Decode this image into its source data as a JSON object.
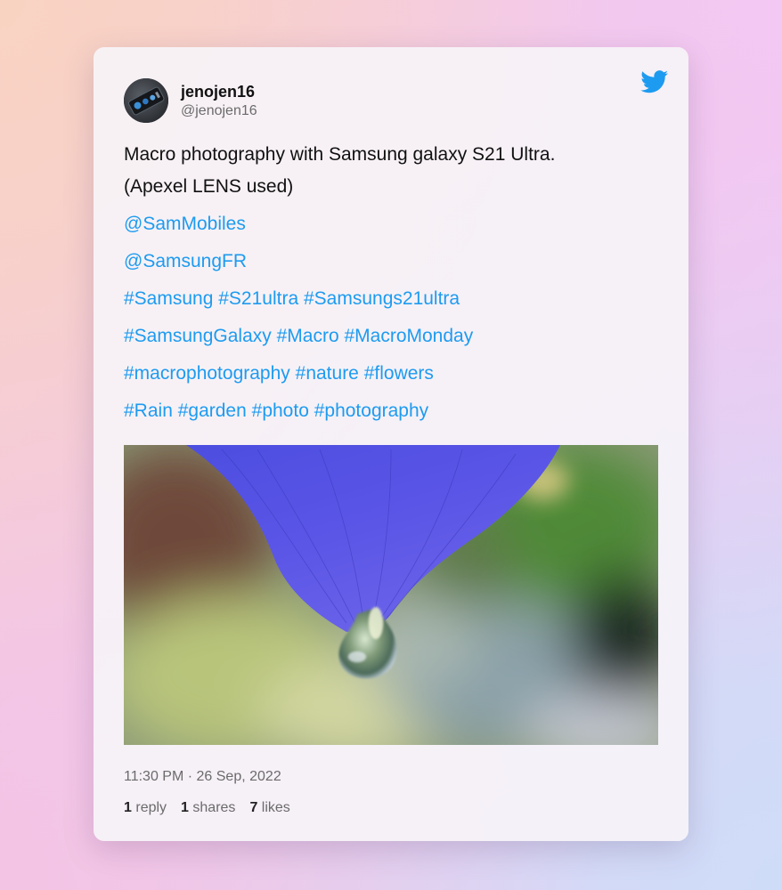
{
  "user": {
    "display_name": "jenojen16",
    "handle": "@jenojen16",
    "avatar_icon": "phone-camera-avatar"
  },
  "brand": {
    "logo_icon": "twitter-bird-icon",
    "accent_color": "#1d9bf0"
  },
  "tweet": {
    "text_line1": "Macro photography with Samsung galaxy S21 Ultra.",
    "text_line2": "(Apexel LENS used)",
    "mention1": "@SamMobiles",
    "mention2": "@SamsungFR",
    "hashtag_lines": [
      [
        "#Samsung",
        "#S21ultra",
        "#Samsungs21ultra"
      ],
      [
        "#SamsungGalaxy",
        "#Macro",
        "#MacroMonday"
      ],
      [
        "#macrophotography",
        "#nature",
        "#flowers"
      ],
      [
        "#Rain",
        "#garden",
        "#photo",
        "#photography"
      ]
    ],
    "image_description_icon": "macro-photo-purple-petal-water-drop",
    "timestamp": "11:30 PM · 26 Sep, 2022"
  },
  "stats": {
    "replies_count": "1",
    "replies_label": "reply",
    "shares_count": "1",
    "shares_label": "shares",
    "likes_count": "7",
    "likes_label": "likes"
  }
}
